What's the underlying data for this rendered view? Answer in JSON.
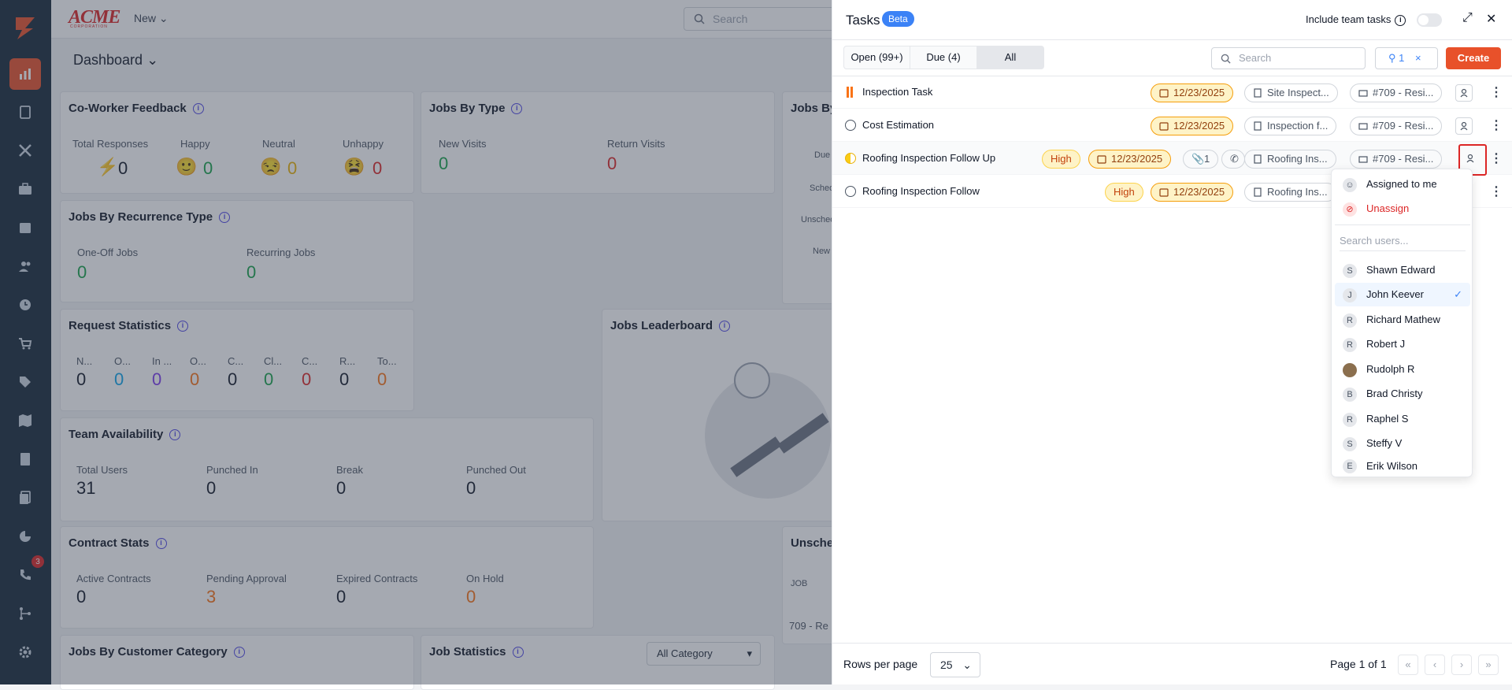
{
  "topbar": {
    "logo": "ACME",
    "logo_sub": "CORPORATION",
    "new_label": "New",
    "search_placeholder": "Search",
    "dashboard_label": "Dashboard"
  },
  "sidebar": {
    "badge": "3",
    "icons": [
      "logo-icon",
      "chart-icon",
      "clipboard-icon",
      "tools-icon",
      "briefcase-icon",
      "calendar-icon",
      "users-icon",
      "clock-icon",
      "cart-icon",
      "tag-icon",
      "map-icon",
      "invoice-icon",
      "documents-icon",
      "pie-icon",
      "phone-icon",
      "flow-icon",
      "settings-icon"
    ]
  },
  "cards": {
    "coworker": {
      "title": "Co-Worker Feedback",
      "labels": [
        "Total Responses",
        "Happy",
        "Neutral",
        "Unhappy"
      ],
      "values": [
        "0",
        "0",
        "0",
        "0"
      ]
    },
    "jobs_type": {
      "title": "Jobs By Type",
      "labels": [
        "New Visits",
        "Return Visits"
      ],
      "values": [
        "0",
        "0"
      ]
    },
    "jobs_by": {
      "title": "Jobs By",
      "rows": [
        "Due",
        "Sched",
        "Unsched",
        "New"
      ]
    },
    "recurrence": {
      "title": "Jobs By Recurrence Type",
      "labels": [
        "One-Off Jobs",
        "Recurring Jobs"
      ],
      "values": [
        "0",
        "0"
      ]
    },
    "request": {
      "title": "Request Statistics",
      "labels": [
        "N...",
        "O...",
        "In ...",
        "O...",
        "C...",
        "Cl...",
        "C...",
        "R...",
        "To..."
      ],
      "values": [
        "0",
        "0",
        "0",
        "0",
        "0",
        "0",
        "0",
        "0",
        "0"
      ]
    },
    "leaderboard": {
      "title": "Jobs Leaderboard"
    },
    "team": {
      "title": "Team Availability",
      "labels": [
        "Total Users",
        "Punched In",
        "Break",
        "Punched Out"
      ],
      "values": [
        "31",
        "0",
        "0",
        "0"
      ]
    },
    "contract": {
      "title": "Contract Stats",
      "labels": [
        "Active Contracts",
        "Pending Approval",
        "Expired Contracts",
        "On Hold"
      ],
      "values": [
        "0",
        "3",
        "0",
        "0"
      ]
    },
    "unsched": {
      "title": "Unsche",
      "col": "JOB",
      "row": "709 - Re"
    },
    "customer": {
      "title": "Jobs By Customer Category"
    },
    "jobstats": {
      "title": "Job Statistics",
      "select": "All Category"
    }
  },
  "panel": {
    "title": "Tasks",
    "beta": "Beta",
    "team_label": "Include team tasks",
    "tabs": [
      "Open (99+)",
      "Due (4)",
      "All"
    ],
    "search_placeholder": "Search",
    "filter_count": "1",
    "create_label": "Create",
    "tasks": [
      {
        "name": "Inspection Task",
        "priority": "",
        "date": "12/23/2025",
        "ref": "Site Inspect...",
        "job": "#709 - Resi..."
      },
      {
        "name": "Cost Estimation",
        "priority": "",
        "date": "12/23/2025",
        "ref": "Inspection f...",
        "job": "#709 - Resi..."
      },
      {
        "name": "Roofing Inspection Follow Up",
        "priority": "High",
        "date": "12/23/2025",
        "attach": "1",
        "ref": "Roofing Ins...",
        "job": "#709 - Resi..."
      },
      {
        "name": "Roofing Inspection Follow",
        "priority": "High",
        "date": "12/23/2025",
        "ref": "Roofing Ins...",
        "job": ""
      }
    ],
    "rows_per_page_label": "Rows per page",
    "rows_per_page": "25",
    "page_of": "Page 1 of 1"
  },
  "dropdown": {
    "assigned_to_me": "Assigned to me",
    "unassign": "Unassign",
    "search_placeholder": "Search users...",
    "users": [
      {
        "initial": "S",
        "name": "Shawn Edward"
      },
      {
        "initial": "J",
        "name": "John Keever",
        "selected": true
      },
      {
        "initial": "R",
        "name": "Richard Mathew"
      },
      {
        "initial": "R",
        "name": "Robert J"
      },
      {
        "initial": "",
        "name": "Rudolph R"
      },
      {
        "initial": "B",
        "name": "Brad Christy"
      },
      {
        "initial": "R",
        "name": "Raphel S"
      },
      {
        "initial": "S",
        "name": "Steffy V"
      },
      {
        "initial": "E",
        "name": "Erik Wilson"
      }
    ]
  }
}
